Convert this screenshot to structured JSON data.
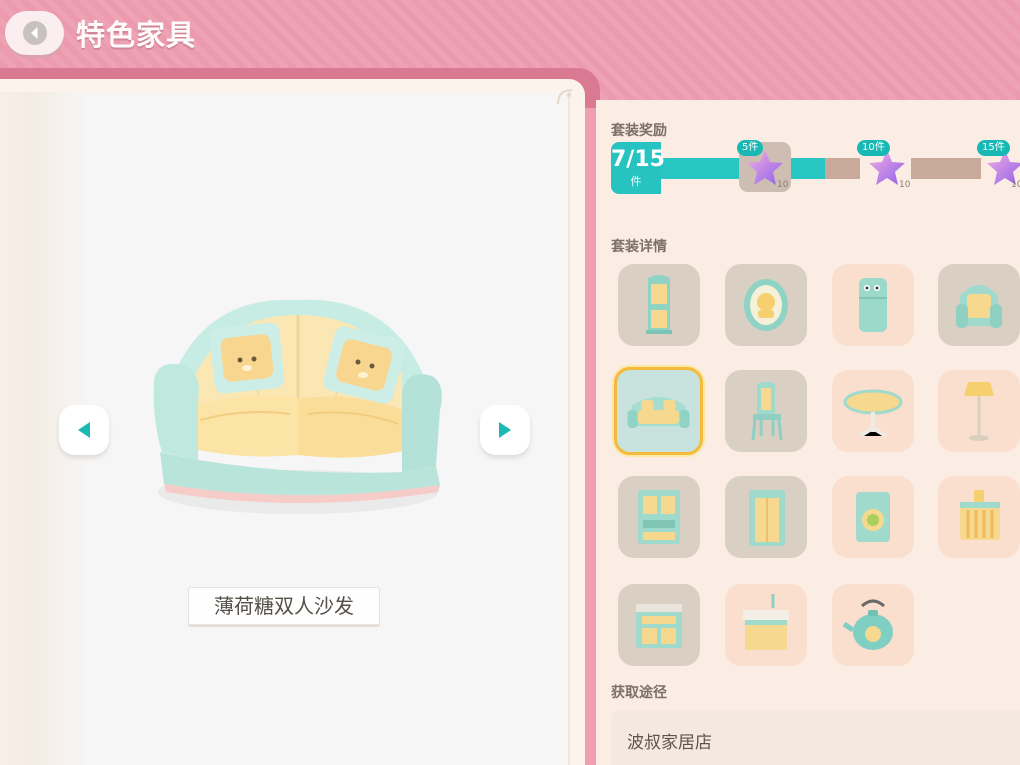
{
  "header": {
    "title": "特色家具",
    "back_icon": "chevron-left-icon"
  },
  "preview": {
    "item_name": "薄荷糖双人沙发",
    "prev_icon": "triangle-left-icon",
    "next_icon": "triangle-right-icon"
  },
  "set_reward": {
    "label": "套装奖励",
    "progress_count": "7/15",
    "progress_unit": "件",
    "progress_fraction": 0.4667,
    "milestones": [
      {
        "tag": "5件",
        "qty": "10",
        "icon": "purple-star-icon"
      },
      {
        "tag": "10件",
        "qty": "10",
        "icon": "purple-star-icon"
      },
      {
        "tag": "15件",
        "qty": "10",
        "icon": "purple-star-icon"
      }
    ]
  },
  "set_details": {
    "label": "套装详情",
    "items": [
      {
        "name": "cabinet",
        "owned": true,
        "selected": false
      },
      {
        "name": "framed-portrait",
        "owned": true,
        "selected": false
      },
      {
        "name": "refrigerator",
        "owned": false,
        "selected": false
      },
      {
        "name": "armchair",
        "owned": true,
        "selected": false
      },
      {
        "name": "sofa",
        "owned": true,
        "selected": true
      },
      {
        "name": "chair",
        "owned": true,
        "selected": false
      },
      {
        "name": "round-table",
        "owned": false,
        "selected": false
      },
      {
        "name": "floor-lamp",
        "owned": false,
        "selected": false
      },
      {
        "name": "bookshelf",
        "owned": true,
        "selected": false
      },
      {
        "name": "wardrobe",
        "owned": true,
        "selected": false
      },
      {
        "name": "washing-machine",
        "owned": false,
        "selected": false
      },
      {
        "name": "wall-shelf",
        "owned": false,
        "selected": false
      },
      {
        "name": "dresser",
        "owned": true,
        "selected": false
      },
      {
        "name": "sink-counter",
        "owned": false,
        "selected": false
      },
      {
        "name": "teapot",
        "owned": false,
        "selected": false
      }
    ]
  },
  "acquire": {
    "label": "获取途径",
    "source": "波叔家居店"
  },
  "colors": {
    "header_pink": "#ec9aad",
    "teal_accent": "#26c3c0",
    "selected_border": "#f5b93d"
  }
}
